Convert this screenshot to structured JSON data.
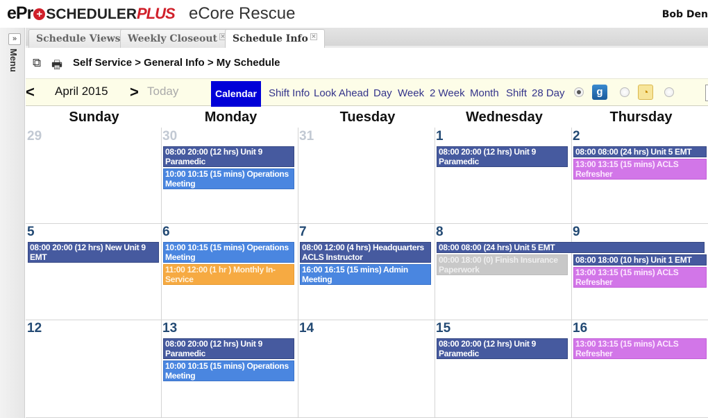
{
  "app": {
    "logo_e": "e",
    "logo_pr": "Pr",
    "logo_cross": "+",
    "logo_scheduler": "SCHEDULER",
    "logo_plus": "PLUS",
    "organization": "eCore Rescue",
    "user_name": "Bob Den"
  },
  "sidebar": {
    "expand_icon": "»",
    "label": "Menu"
  },
  "tabs": [
    {
      "label": "Schedule Views",
      "closable": false,
      "active": false
    },
    {
      "label": "Weekly Closeout",
      "closable": true,
      "active": false
    },
    {
      "label": "Schedule Info",
      "closable": true,
      "active": true
    }
  ],
  "tab_close_glyph": "×",
  "breadcrumb": {
    "icons": {
      "new_window": "⧉",
      "print": "🖶"
    },
    "text": "Self Service > General Info > My Schedule"
  },
  "navigator": {
    "prev": "<",
    "month": "April 2015",
    "next": ">",
    "today": "Today",
    "views": [
      "Calendar",
      "Shift Info",
      "Look Ahead",
      "Day",
      "Week",
      "2 Week",
      "Month",
      "Shift",
      "28 Day"
    ],
    "active_view": "Calendar",
    "sync_options": [
      {
        "name": "google-calendar",
        "glyph": "g",
        "selected": true
      },
      {
        "name": "outlook-calendar",
        "glyph": "◔",
        "selected": false
      },
      {
        "name": "apple-calendar",
        "glyph": "",
        "selected": false
      }
    ]
  },
  "calendar": {
    "weekdays": [
      "Sunday",
      "Monday",
      "Tuesday",
      "Wednesday",
      "Thursday"
    ],
    "weeks": [
      {
        "days": [
          {
            "num": "29",
            "other_month": true,
            "events": []
          },
          {
            "num": "30",
            "other_month": true,
            "events": [
              {
                "type": "shift",
                "text": "08:00 20:00 (12 hrs) Unit 9 Paramedic"
              },
              {
                "type": "meeting",
                "text": "10:00 10:15 (15 mins) Operations Meeting"
              }
            ]
          },
          {
            "num": "31",
            "other_month": true,
            "events": []
          },
          {
            "num": "1",
            "other_month": false,
            "events": [
              {
                "type": "shift",
                "text": "08:00 20:00 (12 hrs) Unit 9 Paramedic"
              }
            ]
          },
          {
            "num": "2",
            "other_month": false,
            "events": [
              {
                "type": "shift",
                "text": "08:00 08:00 (24 hrs) Unit 5 EMT"
              },
              {
                "type": "training",
                "text": "13:00 13:15 (15 mins) ACLS Refresher"
              }
            ]
          }
        ]
      },
      {
        "days": [
          {
            "num": "5",
            "other_month": false,
            "events": [
              {
                "type": "shift",
                "text": "08:00 20:00 (12 hrs) New Unit 9 EMT"
              }
            ]
          },
          {
            "num": "6",
            "other_month": false,
            "events": [
              {
                "type": "meeting",
                "text": "10:00 10:15 (15 mins) Operations Meeting"
              },
              {
                "type": "inservice",
                "text": "11:00 12:00 (1 hr ) Monthly In-Service"
              }
            ]
          },
          {
            "num": "7",
            "other_month": false,
            "events": [
              {
                "type": "shift",
                "text": "08:00 12:00 (4 hrs) Headquarters ACLS Instructor"
              },
              {
                "type": "meeting",
                "text": "16:00 16:15 (15 mins) Admin Meeting"
              }
            ]
          },
          {
            "num": "8",
            "other_month": false,
            "events": [
              {
                "type": "shift",
                "text": "08:00 08:00 (24 hrs) Unit 5 EMT",
                "spans_next_day": true
              },
              {
                "type": "task",
                "text": "00:00 18:00 (0) Finish Insurance Paperwork"
              }
            ]
          },
          {
            "num": "9",
            "other_month": false,
            "events": [
              {
                "type": "shift",
                "text": "08:00 18:00 (10 hrs) Unit 1 EMT"
              },
              {
                "type": "training",
                "text": "13:00 13:15 (15 mins) ACLS Refresher"
              }
            ]
          }
        ]
      },
      {
        "days": [
          {
            "num": "12",
            "other_month": false,
            "events": []
          },
          {
            "num": "13",
            "other_month": false,
            "events": [
              {
                "type": "shift",
                "text": "08:00 20:00 (12 hrs) Unit 9 Paramedic"
              },
              {
                "type": "meeting",
                "text": "10:00 10:15 (15 mins) Operations Meeting"
              }
            ]
          },
          {
            "num": "14",
            "other_month": false,
            "events": []
          },
          {
            "num": "15",
            "other_month": false,
            "events": [
              {
                "type": "shift",
                "text": "08:00 20:00 (12 hrs) Unit 9 Paramedic"
              }
            ]
          },
          {
            "num": "16",
            "other_month": false,
            "events": [
              {
                "type": "training",
                "text": "13:00 13:15 (15 mins) ACLS Refresher"
              }
            ]
          }
        ]
      }
    ]
  },
  "colors": {
    "shift": "#465a9f",
    "meeting": "#4a86e0",
    "training": "#d276e8",
    "inservice": "#f6aa42",
    "task": "#c8c8c8",
    "active_view": "#0000d8"
  }
}
